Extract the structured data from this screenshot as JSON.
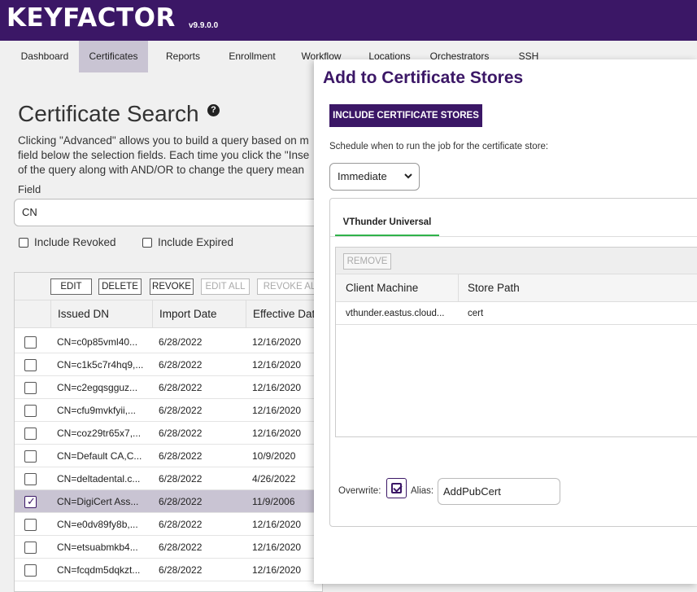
{
  "header": {
    "brand": "KEYFACTOR",
    "version": "v9.9.0.0"
  },
  "nav": [
    {
      "label": "Dashboard"
    },
    {
      "label": "Certificates"
    },
    {
      "label": "Reports"
    },
    {
      "label": "Enrollment"
    },
    {
      "label": "Workflow"
    },
    {
      "label": "Locations"
    },
    {
      "label": "Orchestrators"
    },
    {
      "label": "SSH"
    }
  ],
  "search": {
    "title": "Certificate Search",
    "help": "?",
    "desc": [
      "Clicking \"Advanced\" allows you to build a query based on m",
      "field below the selection fields. Each time you click the \"Inse",
      "of the query along with AND/OR to change the query mean"
    ],
    "field_label": "Field",
    "field_value": "CN",
    "include_revoked": "Include Revoked",
    "include_expired": "Include Expired"
  },
  "grid": {
    "buttons": {
      "edit": "EDIT",
      "delete": "DELETE",
      "revoke": "REVOKE",
      "edit_all": "EDIT ALL",
      "revoke_all": "REVOKE AL"
    },
    "columns": {
      "issued_dn": "Issued DN",
      "import_date": "Import Date",
      "effective_date": "Effective Dat"
    },
    "rows": [
      {
        "dn": "CN=c0p85vml40...",
        "import": "6/28/2022",
        "effective": "12/16/2020"
      },
      {
        "dn": "CN=c1k5c7r4hq9,...",
        "import": "6/28/2022",
        "effective": "12/16/2020"
      },
      {
        "dn": "CN=c2egqsgguz...",
        "import": "6/28/2022",
        "effective": "12/16/2020"
      },
      {
        "dn": "CN=cfu9mvkfyii,...",
        "import": "6/28/2022",
        "effective": "12/16/2020"
      },
      {
        "dn": "CN=coz29tr65x7,...",
        "import": "6/28/2022",
        "effective": "12/16/2020"
      },
      {
        "dn": "CN=Default CA,C...",
        "import": "6/28/2022",
        "effective": "10/9/2020"
      },
      {
        "dn": "CN=deltadental.c...",
        "import": "6/28/2022",
        "effective": "4/26/2022"
      },
      {
        "dn": "CN=DigiCert Ass...",
        "import": "6/28/2022",
        "effective": "11/9/2006"
      },
      {
        "dn": "CN=e0dv89fy8b,...",
        "import": "6/28/2022",
        "effective": "12/16/2020"
      },
      {
        "dn": "CN=etsuabmkb4...",
        "import": "6/28/2022",
        "effective": "12/16/2020"
      },
      {
        "dn": "CN=fcqdm5dqkzt...",
        "import": "6/28/2022",
        "effective": "12/16/2020"
      }
    ]
  },
  "modal": {
    "title": "Add to Certificate Stores",
    "include_button": "INCLUDE CERTIFICATE STORES",
    "schedule_label": "Schedule when to run the job for the certificate store:",
    "schedule_value": "Immediate",
    "tab": "VThunder Universal",
    "remove_button": "REMOVE",
    "columns": {
      "client_machine": "Client Machine",
      "store_path": "Store Path"
    },
    "store_row": {
      "client_machine": "vthunder.eastus.cloud...",
      "store_path": "cert"
    },
    "overwrite_label": "Overwrite:",
    "alias_label": "Alias:",
    "alias_value": "AddPubCert"
  },
  "colors": {
    "brand": "#3b1766",
    "tab_accent": "#2fb34a",
    "selected_row": "#c9c4d3"
  }
}
